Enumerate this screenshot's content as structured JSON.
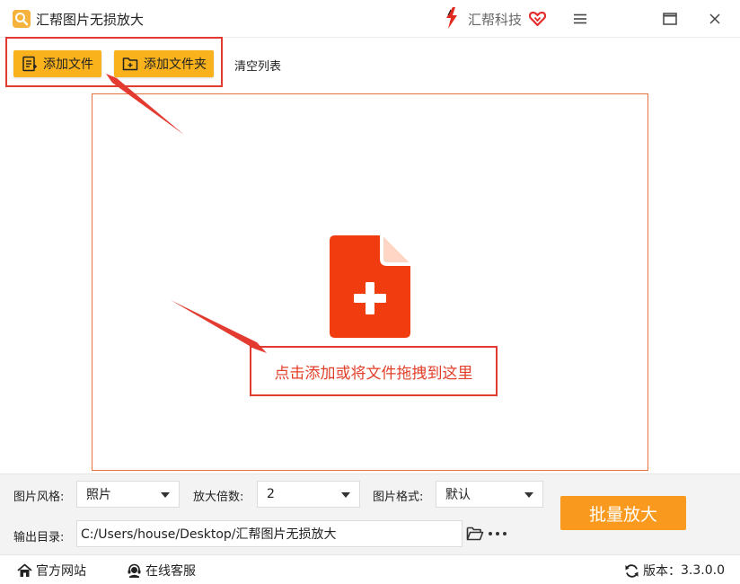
{
  "app": {
    "title": "汇帮图片无损放大",
    "brand_name": "汇帮科技"
  },
  "toolbar": {
    "add_file": "添加文件",
    "add_folder": "添加文件夹",
    "clear_list": "清空列表"
  },
  "dropzone": {
    "hint": "点击添加或将文件拖拽到这里"
  },
  "settings": {
    "style_label": "图片风格:",
    "style_value": "照片",
    "scale_label": "放大倍数:",
    "scale_value": "2",
    "format_label": "图片格式:",
    "format_value": "默认",
    "output_label": "输出目录:",
    "output_path": "C:/Users/house/Desktop/汇帮图片无损放大",
    "batch_button": "批量放大"
  },
  "statusbar": {
    "website": "官方网站",
    "support": "在线客服",
    "version_label": "版本：",
    "version": "3.3.0.0"
  },
  "colors": {
    "accent_yellow": "#f9b21c",
    "accent_orange": "#f99a1e",
    "highlight_red": "#e33b30",
    "icon_red": "#f03c0e"
  }
}
